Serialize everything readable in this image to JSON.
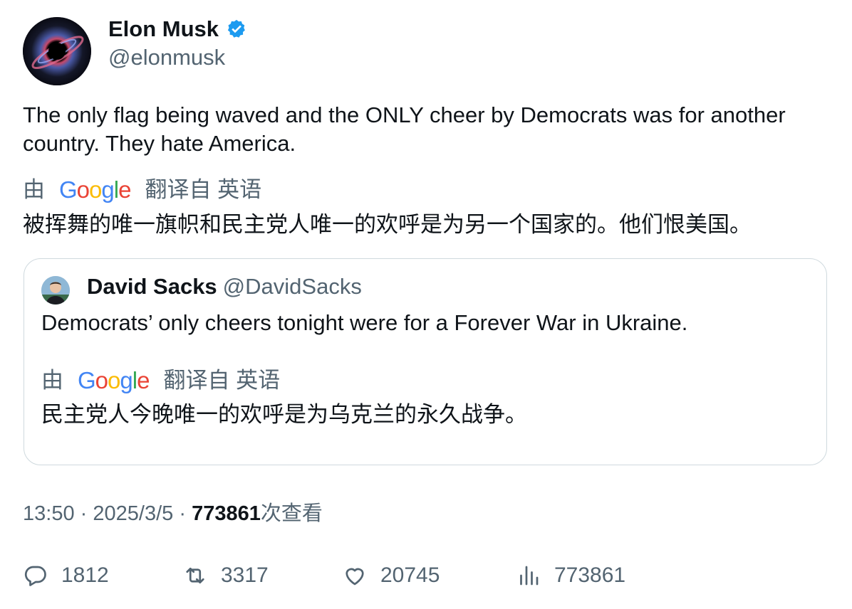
{
  "author": {
    "name": "Elon Musk",
    "handle": "@elonmusk",
    "avatar_icon": "black-hole-avatar",
    "verified_icon": "verified-badge-icon",
    "verified_color": "#1d9bf0"
  },
  "tweet": {
    "text": "The only flag being waved and the ONLY cheer by Democrats was for another country. They hate America.",
    "translation": {
      "prefix": "由",
      "logo": "Google",
      "suffix": "翻译自 英语",
      "text": "被挥舞的唯一旗帜和民主党人唯一的欢呼是为另一个国家的。他们恨美国。"
    }
  },
  "quote": {
    "name": "David Sacks",
    "handle": "@DavidSacks",
    "avatar_icon": "person-avatar",
    "text": "Democrats’ only cheers tonight were for a Forever War in Ukraine.",
    "translation": {
      "prefix": "由",
      "logo": "Google",
      "suffix": "翻译自 英语",
      "text": "民主党人今晚唯一的欢呼是为乌克兰的永久战争。"
    }
  },
  "meta": {
    "time": "13:50",
    "separator": "·",
    "date": "2025/3/5",
    "views": "773861",
    "views_suffix": "次查看"
  },
  "actions": {
    "reply": {
      "icon": "reply-icon",
      "count": "1812"
    },
    "retweet": {
      "icon": "retweet-icon",
      "count": "3317"
    },
    "like": {
      "icon": "heart-icon",
      "count": "20745"
    },
    "views": {
      "icon": "bar-chart-icon",
      "count": "773861"
    }
  },
  "colors": {
    "text": "#0f1419",
    "secondary": "#536471",
    "border": "#cfd9de"
  }
}
